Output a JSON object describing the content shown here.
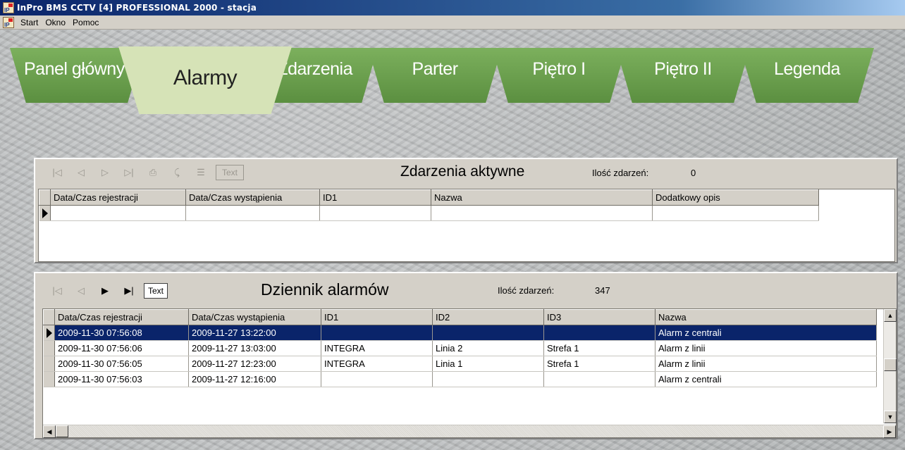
{
  "window": {
    "title": "InPro BMS  CCTV [4] PROFESSIONAL 2000 - stacja"
  },
  "menu": {
    "items": [
      "Start",
      "Okno",
      "Pomoc"
    ]
  },
  "tabs": [
    {
      "label": "Panel główny",
      "active": false
    },
    {
      "label": "Alarmy",
      "active": true
    },
    {
      "label": "Zdarzenia",
      "active": false
    },
    {
      "label": "Parter",
      "active": false
    },
    {
      "label": "Piętro I",
      "active": false
    },
    {
      "label": "Piętro II",
      "active": false
    },
    {
      "label": "Legenda",
      "active": false
    }
  ],
  "active_events": {
    "title": "Zdarzenia aktywne",
    "count_label": "Ilość zdarzeń:",
    "count": "0",
    "text_button": "Text",
    "columns": [
      "Data/Czas rejestracji",
      "Data/Czas wystąpienia",
      "ID1",
      "Nazwa",
      "Dodatkowy opis"
    ],
    "rows": []
  },
  "alarm_log": {
    "title": "Dziennik alarmów",
    "count_label": "Ilość zdarzeń:",
    "count": "347",
    "text_button": "Text",
    "columns": [
      "Data/Czas rejestracji",
      "Data/Czas wystąpienia",
      "ID1",
      "ID2",
      "ID3",
      "Nazwa"
    ],
    "rows": [
      [
        "2009-11-30 07:56:08",
        "2009-11-27 13:22:00",
        "",
        "",
        "",
        "Alarm z centrali"
      ],
      [
        "2009-11-30 07:56:06",
        "2009-11-27 13:03:00",
        "INTEGRA",
        "Linia 2",
        "Strefa 1",
        "Alarm z linii"
      ],
      [
        "2009-11-30 07:56:05",
        "2009-11-27 12:23:00",
        "INTEGRA",
        "Linia 1",
        "Strefa 1",
        "Alarm z linii"
      ],
      [
        "2009-11-30 07:56:03",
        "2009-11-27 12:16:00",
        "",
        "",
        "",
        "Alarm z centrali"
      ]
    ],
    "selected_row": 0
  },
  "colors": {
    "tab_green": "#6a9e4c",
    "tab_active": "#d6e3b7",
    "selection": "#0a246a",
    "panel": "#d4d0c8"
  }
}
